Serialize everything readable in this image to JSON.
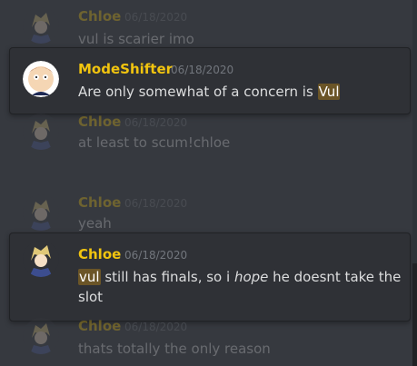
{
  "messages": [
    {
      "author": "Chloe",
      "time": "06/18/2020",
      "text": "vul is scarier imo"
    },
    {
      "author": "ModeShifter",
      "time": "06/18/2020",
      "text_before": "Are only somewhat of a concern is ",
      "highlight": "Vul"
    },
    {
      "author": "Chloe",
      "time": "06/18/2020",
      "text": "at least to scum!chloe"
    },
    {
      "author": "Chloe",
      "time": "06/18/2020",
      "text": "yeah"
    },
    {
      "author": "Chloe",
      "time": "06/18/2020",
      "highlight": "vul",
      "text_mid": " still has finals, so i ",
      "emphasis": "hope",
      "text_after": " he doesnt take the",
      "text_line2": "slot"
    },
    {
      "author": "Chloe",
      "time": "06/18/2020",
      "text": "thats totally the only reason"
    }
  ],
  "colors": {
    "background": "#36393f",
    "card": "#2f3136",
    "author_chloe": "#f1c40f",
    "author_modeshifter": "#f1c40f",
    "highlight": "#6b5527"
  },
  "icons": {
    "chloe_avatar": "anime-character-avatar",
    "modeshifter_avatar": "cartoon-character-avatar"
  }
}
